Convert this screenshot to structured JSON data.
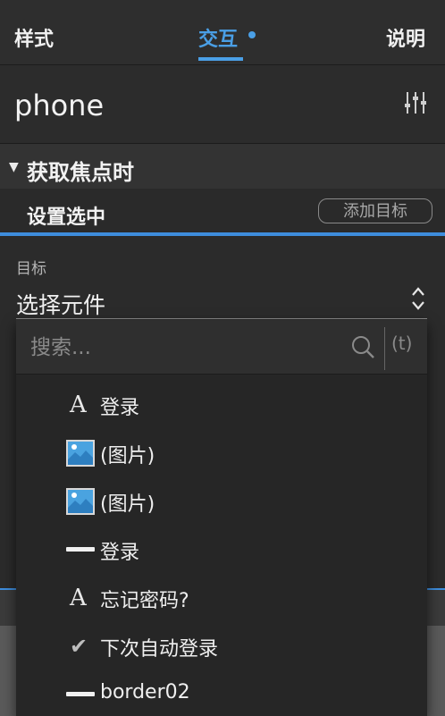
{
  "tabs": {
    "style": "样式",
    "interaction": "交互",
    "notes": "说明"
  },
  "header": {
    "widget_name": "phone"
  },
  "section": {
    "title": "获取焦点时"
  },
  "action": {
    "title": "设置选中",
    "add_target": "添加目标"
  },
  "target": {
    "label": "目标",
    "select_value": "选择元件"
  },
  "search": {
    "placeholder": "搜索...",
    "toggle_label": "(t)"
  },
  "items": [
    {
      "icon": "text-icon",
      "glyph": "A",
      "label": "登录"
    },
    {
      "icon": "image-icon",
      "label": "(图片)"
    },
    {
      "icon": "image-icon",
      "label": "(图片)"
    },
    {
      "icon": "line-icon",
      "label": "登录"
    },
    {
      "icon": "text-icon",
      "glyph": "A",
      "label": "忘记密码?"
    },
    {
      "icon": "checkbox-icon",
      "glyph": "✔",
      "label": "下次自动登录"
    },
    {
      "icon": "line-icon",
      "label": "border02"
    }
  ],
  "colors": {
    "accent": "#4a9fe6",
    "background": "#2b2b2b"
  }
}
